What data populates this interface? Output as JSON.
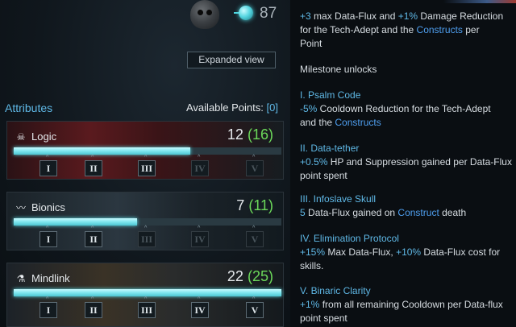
{
  "header": {
    "level_value": "87",
    "expanded_view_label": "Expanded view"
  },
  "attributes": {
    "title": "Attributes",
    "available_label": "Available Points: ",
    "available_open": "[",
    "available_value": "0",
    "available_close": "]",
    "items": [
      {
        "name": "Logic",
        "icon": "skull-icon",
        "icon_glyph": "☠",
        "value": "12",
        "bonus": "16",
        "progress_fraction": 0.66,
        "tiers": [
          {
            "label": "I",
            "unlocked": true
          },
          {
            "label": "II",
            "unlocked": true
          },
          {
            "label": "III",
            "unlocked": true
          },
          {
            "label": "IV",
            "unlocked": false
          },
          {
            "label": "V",
            "unlocked": false
          }
        ]
      },
      {
        "name": "Bionics",
        "icon": "pulse-icon",
        "icon_glyph": "〰",
        "value": "7",
        "bonus": "11",
        "progress_fraction": 0.46,
        "tiers": [
          {
            "label": "I",
            "unlocked": true
          },
          {
            "label": "II",
            "unlocked": true
          },
          {
            "label": "III",
            "unlocked": false
          },
          {
            "label": "IV",
            "unlocked": false
          },
          {
            "label": "V",
            "unlocked": false
          }
        ]
      },
      {
        "name": "Mindlink",
        "icon": "vial-icon",
        "icon_glyph": "⚗",
        "value": "22",
        "bonus": "25",
        "progress_fraction": 1.0,
        "tiers": [
          {
            "label": "I",
            "unlocked": true
          },
          {
            "label": "II",
            "unlocked": true
          },
          {
            "label": "III",
            "unlocked": true
          },
          {
            "label": "IV",
            "unlocked": true
          },
          {
            "label": "V",
            "unlocked": true
          }
        ]
      }
    ]
  },
  "details": {
    "top": {
      "p1_a": "+3",
      "p1_b": " max Data-Flux and ",
      "p1_c": "+1%",
      "p1_d": " Damage Reduction",
      "p2_a": "for the Tech-Adept and the ",
      "p2_b": "Constructs",
      "p2_c": " per",
      "p3": "Point"
    },
    "milestone_title": "Milestone unlocks",
    "m1": {
      "title": "I. Psalm Code",
      "a": "-5%",
      "b": " Cooldown Reduction for the Tech-Adept",
      "c": "and the ",
      "d": "Constructs"
    },
    "m2": {
      "title": "II. Data-tether",
      "a": "+0.5%",
      "b": " HP and Suppression gained per Data-Flux",
      "c": "point spent"
    },
    "m3": {
      "title": "III. Infoslave Skull",
      "a": "5",
      "b": " Data-Flux gained on ",
      "c": "Construct",
      "d": " death"
    },
    "m4": {
      "title": "IV. Elimination Protocol",
      "a": "+15%",
      "b": " Max Data-Flux, ",
      "c": "+10%",
      "d": " Data-Flux cost for",
      "e": "skills."
    },
    "m5": {
      "title": "V. Binaric Clarity",
      "a": "+1%",
      "b": " from all remaining Cooldown per Data-flux",
      "c": "point spent"
    }
  },
  "colors": {
    "accent_cyan": "#5fb8e6",
    "link_blue": "#4f9ff0",
    "bonus_green": "#6bd85a",
    "bar_fill": "#7ee6ef"
  }
}
